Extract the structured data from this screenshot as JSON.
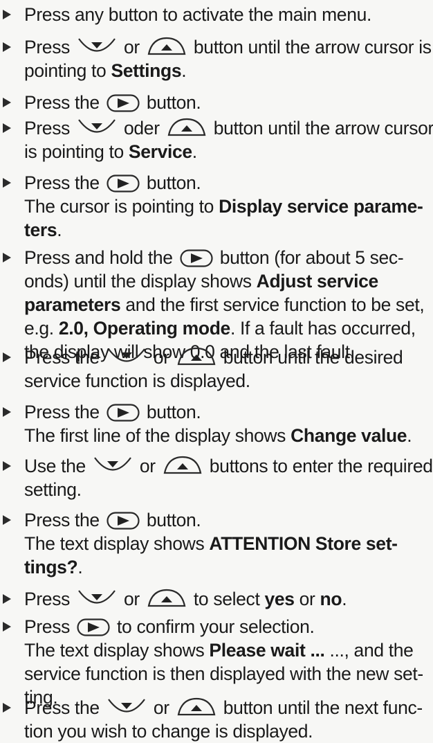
{
  "steps": [
    {
      "lines": [
        [
          "Press any button to activate the main menu."
        ]
      ]
    },
    {
      "lines": [
        [
          "Press ",
          "{down}",
          " or ",
          "{up}",
          " button until the arrow cursor is"
        ],
        [
          "pointing to ",
          "**Settings",
          "."
        ]
      ]
    },
    {
      "lines": [
        [
          "Press the ",
          "{right}",
          " button."
        ]
      ]
    },
    {
      "lines": [
        [
          "Press ",
          "{down}",
          " oder ",
          "{up}",
          " button until the arrow cursor"
        ],
        [
          "is pointing to ",
          "**Service",
          "."
        ]
      ]
    },
    {
      "lines": [
        [
          "Press the ",
          "{right}",
          " button."
        ],
        [
          "The cursor is pointing to ",
          "**Display service parame-"
        ],
        [
          "**ters",
          "."
        ]
      ]
    },
    {
      "lines": [
        [
          "Press and hold the ",
          "{right}",
          " button (for about 5 sec-"
        ],
        [
          "onds) until the display shows ",
          "**Adjust service"
        ],
        [
          "**parameters",
          " and the first service function to be set,"
        ],
        [
          "e.g. ",
          "**2.0, Operating mode",
          ". If a fault has occurred,"
        ],
        [
          "the display will show 0.0 and the last fault."
        ]
      ]
    },
    {
      "lines": [
        [
          "Press the ",
          "{down}",
          " or ",
          "{up}",
          " button until the desired"
        ],
        [
          "service function is displayed."
        ]
      ]
    },
    {
      "lines": [
        [
          "Press the ",
          "{right}",
          " button."
        ],
        [
          "The first line of the display shows ",
          "**Change value",
          "."
        ]
      ]
    },
    {
      "lines": [
        [
          "Use the ",
          "{down}",
          " or ",
          "{up}",
          " buttons to enter the required"
        ],
        [
          "setting."
        ]
      ]
    },
    {
      "lines": [
        [
          "Press the ",
          "{right}",
          " button."
        ],
        [
          "The text display shows ",
          "**ATTENTION Store set-"
        ],
        [
          "**tings?",
          "."
        ]
      ]
    },
    {
      "lines": [
        [
          "Press ",
          "{down}",
          " or ",
          "{up}",
          " to select ",
          "**yes",
          " or ",
          "**no",
          "."
        ]
      ]
    },
    {
      "lines": [
        [
          "Press ",
          "{right}",
          " to confirm your selection."
        ],
        [
          "The text display shows ",
          "**Please wait ...",
          " ..., and the"
        ],
        [
          "service function is then displayed with the new set-"
        ],
        [
          "ting."
        ]
      ]
    },
    {
      "lines": [
        [
          "Press the ",
          "{down}",
          " or ",
          "{up}",
          " button until the next func-"
        ],
        [
          "tion you wish to change is displayed."
        ]
      ]
    }
  ],
  "icons": {
    "bullet": "triangle-bullet-icon",
    "down": "down-arrow-button-icon",
    "up": "up-arrow-button-icon",
    "right": "right-arrow-button-icon"
  },
  "colors": {
    "text": "#1a1a1a",
    "paper": "#f7f7f5"
  }
}
